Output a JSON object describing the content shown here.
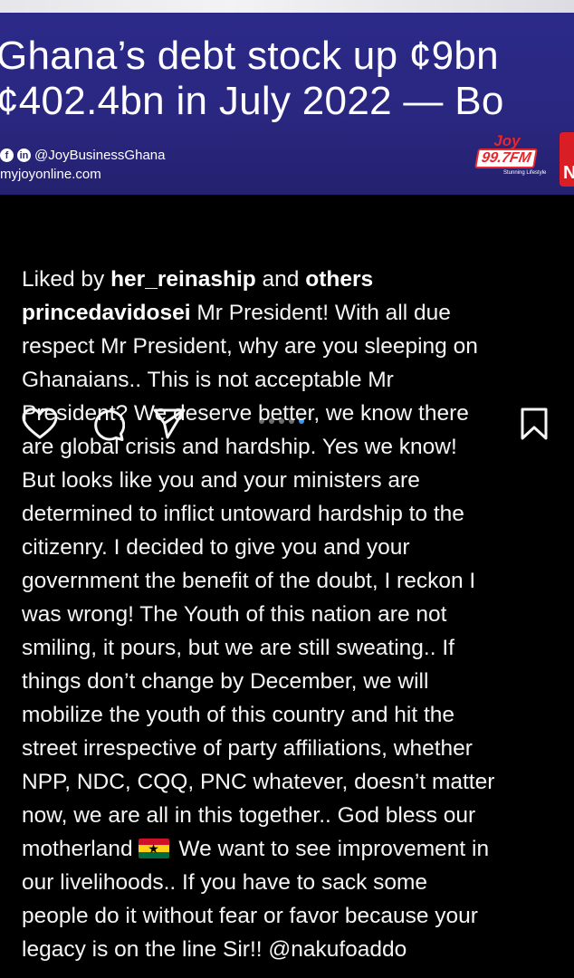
{
  "banner": {
    "headline_line1": "Ghana’s debt stock up ¢9bn",
    "headline_line2": "¢402.4bn in July 2022 — Bo",
    "social_handle": "@JoyBusinessGhana",
    "site_url": "myjoyonline.com",
    "logo_joy": "Joy",
    "logo_fm": "99.7FM",
    "logo_tagline": "Stunning Lifestyle",
    "logo_partial_letter": "N",
    "colors": {
      "background": "#2a2780",
      "logo_red": "#e8262b"
    }
  },
  "actions": {
    "icons": [
      "heart-icon",
      "comment-icon",
      "share-icon",
      "bookmark-icon"
    ],
    "carousel": {
      "total": 5,
      "active_index": 4
    }
  },
  "post": {
    "likes_prefix": "Liked by ",
    "liked_by_user": "her_reinaship",
    "likes_and": " and ",
    "likes_others": "others",
    "author": "princedavidosei",
    "caption_lines": [
      " Mr President! With all due",
      "respect Mr President, why are you sleeping on",
      "Ghanaians.. This is not acceptable Mr",
      "President? We deserve better, we know there",
      "are global crisis and hardship. Yes we know!",
      "But looks like you and your ministers are",
      "determined to inflict untoward hardship to the",
      "citizenry. I decided to give you and your",
      "government the benefit of the doubt, I reckon I",
      "was wrong! The Youth of this nation are not",
      "smiling, it pours, but we are still sweating.. If",
      "things don’t change by December, we will",
      "mobilize the youth of this country and hit the",
      "street irrespective of party affiliations, whether",
      "NPP, NDC, CQQ, PNC whatever, doesn’t matter",
      "now, we are all in this together.. God bless our"
    ],
    "flag_line_before": "motherland",
    "flag_line_after": " We want to see improvement in",
    "caption_tail": [
      "our livelihoods.. If you have to sack some",
      "people do it without fear or favor because your",
      "legacy is on the line Sir!! @nakufoaddo"
    ],
    "flag_emoji": "ghana-flag-icon"
  }
}
